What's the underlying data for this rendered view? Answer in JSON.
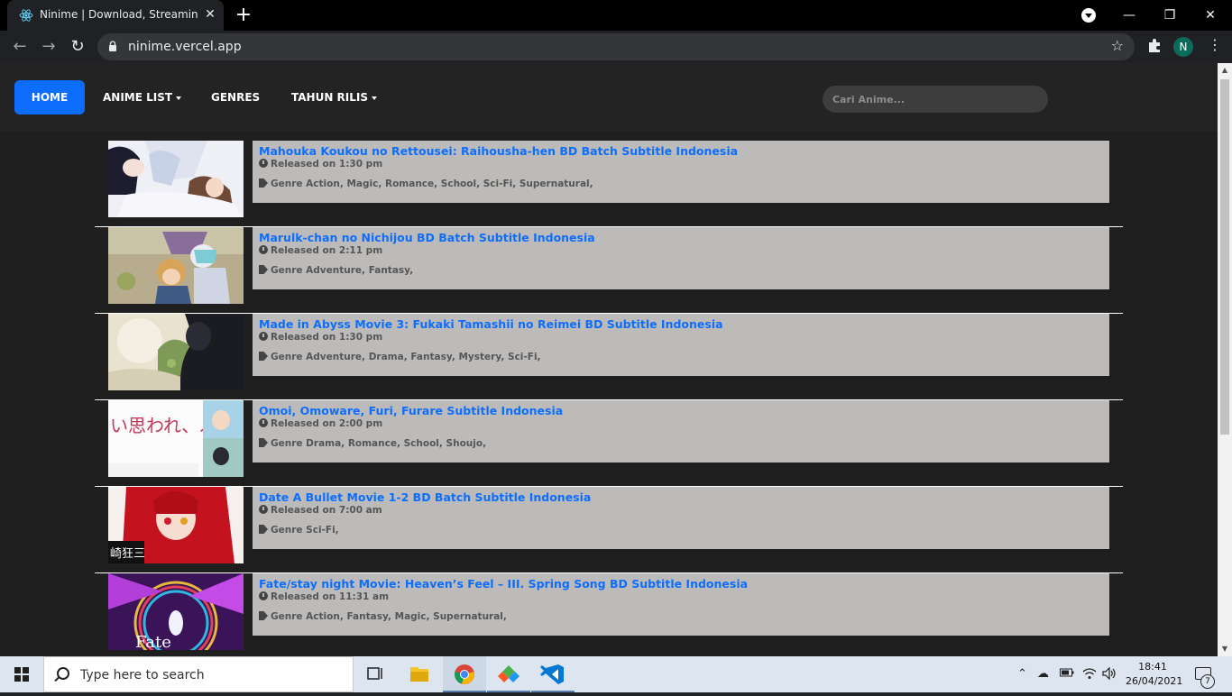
{
  "browser": {
    "tab_title": "Ninime | Download, Streaming Anime",
    "tab_close": "✕",
    "new_tab": "+",
    "url": "ninime.vercel.app",
    "profile_initial": "N",
    "minimize": "—",
    "maximize": "❐",
    "close": "✕"
  },
  "site_nav": {
    "home": "HOME",
    "anime_list": "ANIME LIST",
    "genres": "GENRES",
    "tahun_rilis": "TAHUN RILIS",
    "search_placeholder": "Cari Anime..."
  },
  "anime_list": [
    {
      "title": "Mahouka Koukou no Rettousei: Raihousha-hen BD Batch Subtitle Indonesia",
      "released": "Released on 1:30 pm",
      "genre": "Genre Action, Magic, Romance, School, Sci-Fi, Supernatural,"
    },
    {
      "title": "Marulk-chan no Nichijou BD Batch Subtitle Indonesia",
      "released": "Released on 2:11 pm",
      "genre": "Genre Adventure, Fantasy,"
    },
    {
      "title": "Made in Abyss Movie 3: Fukaki Tamashii no Reimei BD Subtitle Indonesia",
      "released": "Released on 1:30 pm",
      "genre": "Genre Adventure, Drama, Fantasy, Mystery, Sci-Fi,"
    },
    {
      "title": "Omoi, Omoware, Furi, Furare Subtitle Indonesia",
      "released": "Released on 2:00 pm",
      "genre": "Genre Drama, Romance, School, Shoujo,"
    },
    {
      "title": "Date A Bullet Movie 1-2 BD Batch Subtitle Indonesia",
      "released": "Released on 7:00 am",
      "genre": "Genre Sci-Fi,"
    },
    {
      "title": "Fate/stay night Movie: Heaven’s Feel – III. Spring Song BD Subtitle Indonesia",
      "released": "Released on 11:31 am",
      "genre": "Genre Action, Fantasy, Magic, Supernatural,"
    }
  ],
  "thumbnails": {
    "omoi_text": "い思われ、ふり、ふられ",
    "date_text": "崎狂三",
    "fate_text": "Fate"
  },
  "taskbar": {
    "search_placeholder": "Type here to search",
    "time": "18:41",
    "date": "26/04/2021",
    "notification_count": "7"
  },
  "colors": {
    "accent": "#0d6efd",
    "card_bg": "#bdbbb9",
    "page_bg": "#1f1f1f"
  }
}
